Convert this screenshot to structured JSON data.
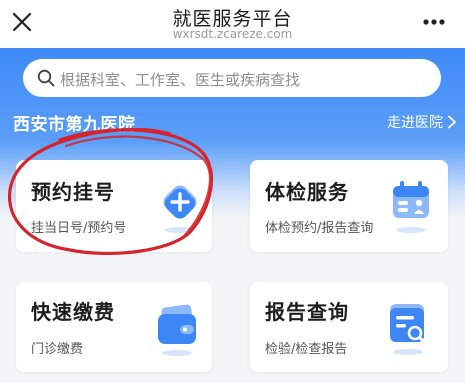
{
  "topbar": {
    "title": "就医服务平台",
    "url": "wxrsdt.zcareze.com",
    "close_icon": "close-icon",
    "more_icon": "more-icon"
  },
  "search": {
    "placeholder": "根据科室、工作室、医生或疾病查找"
  },
  "hospital": {
    "name": "西安市第九医院",
    "enter_label": "走进医院"
  },
  "cards": [
    {
      "title": "预约挂号",
      "subtitle": "挂当日号/预约号",
      "icon": "plus-icon",
      "color": "#3d86f5"
    },
    {
      "title": "体检服务",
      "subtitle": "体检预约/报告查询",
      "icon": "calendar-person-icon",
      "color": "#3d86f5"
    },
    {
      "title": "快速缴费",
      "subtitle": "门诊缴费",
      "icon": "wallet-icon",
      "color": "#3d86f5"
    },
    {
      "title": "报告查询",
      "subtitle": "检验/检查报告",
      "icon": "report-search-icon",
      "color": "#3d86f5"
    }
  ],
  "colors": {
    "brand_blue": "#3f8af7",
    "annotation_red": "#d6242b"
  }
}
